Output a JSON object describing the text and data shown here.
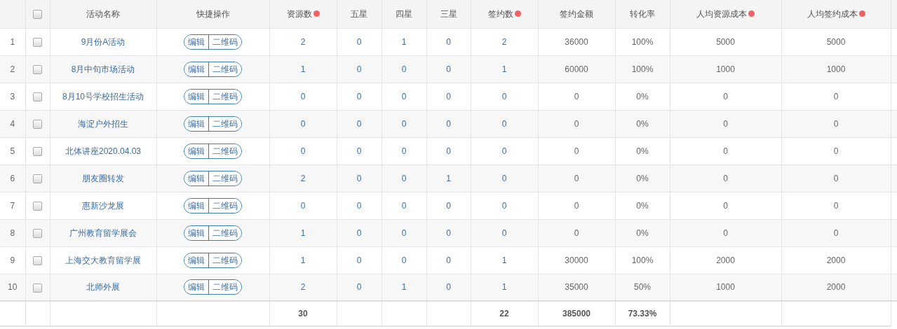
{
  "header_checked": false,
  "columns": [
    {
      "kind": "index"
    },
    {
      "kind": "select"
    },
    {
      "kind": "name",
      "label": "活动名称",
      "dot": false
    },
    {
      "kind": "actions",
      "label": "快捷操作",
      "dot": false
    },
    {
      "kind": "count",
      "label": "资源数",
      "dot": true
    },
    {
      "kind": "count",
      "label": "五星",
      "dot": false
    },
    {
      "kind": "count",
      "label": "四星",
      "dot": false
    },
    {
      "kind": "count",
      "label": "三星",
      "dot": false
    },
    {
      "kind": "count",
      "label": "签约数",
      "dot": true
    },
    {
      "kind": "amount",
      "label": "签约金额",
      "dot": false
    },
    {
      "kind": "amount",
      "label": "转化率",
      "dot": false
    },
    {
      "kind": "amount",
      "label": "人均资源成本",
      "dot": true
    },
    {
      "kind": "amount",
      "label": "人均签约成本",
      "dot": true
    }
  ],
  "rows": [
    {
      "index": "1",
      "checked": false,
      "name": "9月份A活动",
      "actions": [
        "编辑",
        "二维码"
      ],
      "values": [
        "2",
        "0",
        "1",
        "0",
        "2",
        "36000",
        "100%",
        "5000",
        "5000"
      ]
    },
    {
      "index": "2",
      "checked": false,
      "name": "8月中旬市场活动",
      "actions": [
        "编辑",
        "二维码"
      ],
      "values": [
        "1",
        "0",
        "0",
        "0",
        "1",
        "60000",
        "100%",
        "1000",
        "1000"
      ]
    },
    {
      "index": "3",
      "checked": false,
      "name": "8月10号学校招生活动",
      "actions": [
        "编辑",
        "二维码"
      ],
      "values": [
        "0",
        "0",
        "0",
        "0",
        "0",
        "0",
        "0%",
        "0",
        "0"
      ]
    },
    {
      "index": "4",
      "checked": false,
      "name": "海淀户外招生",
      "actions": [
        "编辑",
        "二维码"
      ],
      "values": [
        "0",
        "0",
        "0",
        "0",
        "0",
        "0",
        "0%",
        "0",
        "0"
      ]
    },
    {
      "index": "5",
      "checked": false,
      "name": "北体讲座2020.04.03",
      "actions": [
        "编辑",
        "二维码"
      ],
      "values": [
        "0",
        "0",
        "0",
        "0",
        "0",
        "0",
        "0%",
        "0",
        "0"
      ]
    },
    {
      "index": "6",
      "checked": false,
      "name": "朋友圈转发",
      "actions": [
        "编辑",
        "二维码"
      ],
      "values": [
        "2",
        "0",
        "0",
        "1",
        "0",
        "0",
        "0%",
        "0",
        "0"
      ]
    },
    {
      "index": "7",
      "checked": false,
      "name": "惠新沙龙展",
      "actions": [
        "编辑",
        "二维码"
      ],
      "values": [
        "0",
        "0",
        "0",
        "0",
        "0",
        "0",
        "0%",
        "0",
        "0"
      ]
    },
    {
      "index": "8",
      "checked": false,
      "name": "广州教育留学展会",
      "actions": [
        "编辑",
        "二维码"
      ],
      "values": [
        "1",
        "0",
        "0",
        "0",
        "0",
        "0",
        "0%",
        "0",
        "0"
      ]
    },
    {
      "index": "9",
      "checked": false,
      "name": "上海交大教育留学展",
      "actions": [
        "编辑",
        "二维码"
      ],
      "values": [
        "1",
        "0",
        "0",
        "0",
        "1",
        "30000",
        "100%",
        "2000",
        "2000"
      ]
    },
    {
      "index": "10",
      "checked": false,
      "name": "北师外展",
      "actions": [
        "编辑",
        "二维码"
      ],
      "values": [
        "2",
        "0",
        "1",
        "0",
        "1",
        "35000",
        "50%",
        "1000",
        "2000"
      ]
    }
  ],
  "footer": {
    "resources": "30",
    "signed": "22",
    "amount": "385000",
    "rate": "73.33%"
  }
}
